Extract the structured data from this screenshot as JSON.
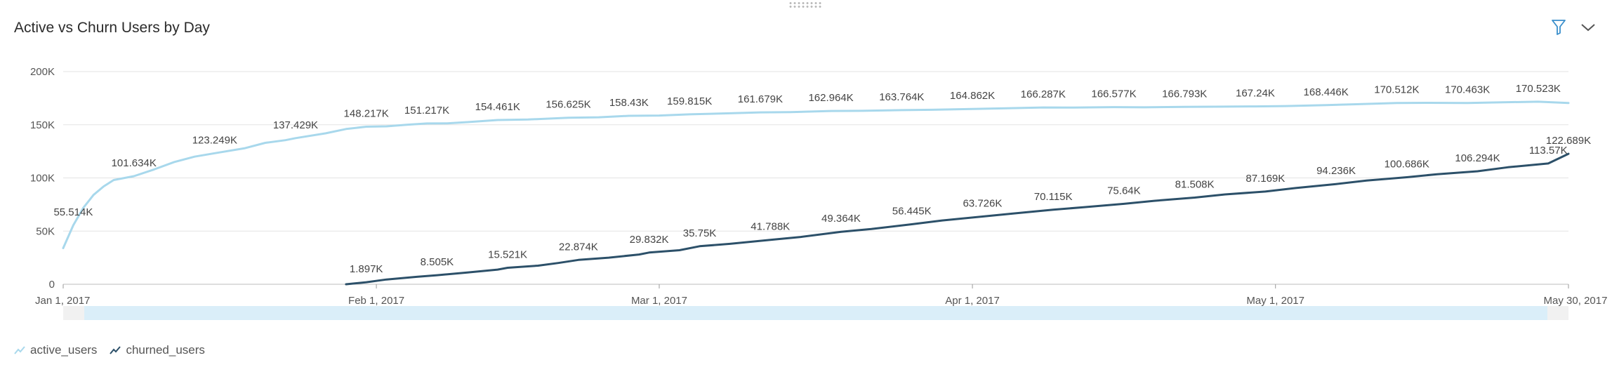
{
  "header": {
    "title": "Active vs Churn Users by Day",
    "filter_icon": "filter-icon",
    "collapse_icon": "chevron-down-icon"
  },
  "colors": {
    "active_users": "#a8d8ec",
    "churned_users": "#2c5069",
    "grid": "#e3e3e3",
    "slider": "#daeef9"
  },
  "chart_data": {
    "type": "line",
    "title": "Active vs Churn Users by Day",
    "xlabel": "",
    "ylabel": "",
    "x_range": [
      "2017-01-01",
      "2017-05-30"
    ],
    "ylim": [
      0,
      200000
    ],
    "y_ticks": [
      {
        "value": 0,
        "label": "0"
      },
      {
        "value": 50000,
        "label": "50K"
      },
      {
        "value": 100000,
        "label": "100K"
      },
      {
        "value": 150000,
        "label": "150K"
      },
      {
        "value": 200000,
        "label": "200K"
      }
    ],
    "x_ticks": [
      {
        "date": "2017-01-01",
        "label": "Jan 1, 2017"
      },
      {
        "date": "2017-02-01",
        "label": "Feb 1, 2017"
      },
      {
        "date": "2017-03-01",
        "label": "Mar 1, 2017"
      },
      {
        "date": "2017-04-01",
        "label": "Apr 1, 2017"
      },
      {
        "date": "2017-05-01",
        "label": "May 1, 2017"
      },
      {
        "date": "2017-05-30",
        "label": "May 30, 2017"
      }
    ],
    "grid": true,
    "legend": "bottom-left",
    "series": [
      {
        "name": "active_users",
        "points": [
          [
            "2017-01-01",
            34000
          ],
          [
            "2017-01-02",
            55514
          ],
          [
            "2017-01-03",
            72000
          ],
          [
            "2017-01-04",
            84000
          ],
          [
            "2017-01-05",
            92000
          ],
          [
            "2017-01-06",
            98000
          ],
          [
            "2017-01-08",
            101634
          ],
          [
            "2017-01-10",
            108000
          ],
          [
            "2017-01-12",
            115000
          ],
          [
            "2017-01-14",
            120000
          ],
          [
            "2017-01-16",
            123249
          ],
          [
            "2017-01-19",
            128000
          ],
          [
            "2017-01-21",
            133000
          ],
          [
            "2017-01-23",
            135500
          ],
          [
            "2017-01-24",
            137429
          ],
          [
            "2017-01-27",
            142000
          ],
          [
            "2017-01-29",
            146000
          ],
          [
            "2017-01-31",
            148217
          ],
          [
            "2017-02-02",
            148500
          ],
          [
            "2017-02-04",
            150000
          ],
          [
            "2017-02-06",
            151217
          ],
          [
            "2017-02-08",
            151300
          ],
          [
            "2017-02-10",
            152500
          ],
          [
            "2017-02-13",
            154461
          ],
          [
            "2017-02-16",
            154900
          ],
          [
            "2017-02-20",
            156625
          ],
          [
            "2017-02-23",
            157000
          ],
          [
            "2017-02-26",
            158430
          ],
          [
            "2017-03-01",
            158700
          ],
          [
            "2017-03-04",
            159815
          ],
          [
            "2017-03-08",
            160800
          ],
          [
            "2017-03-11",
            161679
          ],
          [
            "2017-03-14",
            161900
          ],
          [
            "2017-03-18",
            162964
          ],
          [
            "2017-03-21",
            163100
          ],
          [
            "2017-03-25",
            163764
          ],
          [
            "2017-03-28",
            164100
          ],
          [
            "2017-04-01",
            164862
          ],
          [
            "2017-04-04",
            165400
          ],
          [
            "2017-04-08",
            166287
          ],
          [
            "2017-04-11",
            166200
          ],
          [
            "2017-04-15",
            166577
          ],
          [
            "2017-04-18",
            166400
          ],
          [
            "2017-04-22",
            166793
          ],
          [
            "2017-04-25",
            167000
          ],
          [
            "2017-04-29",
            167240
          ],
          [
            "2017-05-02",
            167600
          ],
          [
            "2017-05-06",
            168446
          ],
          [
            "2017-05-09",
            169300
          ],
          [
            "2017-05-13",
            170512
          ],
          [
            "2017-05-16",
            170600
          ],
          [
            "2017-05-20",
            170463
          ],
          [
            "2017-05-23",
            171000
          ],
          [
            "2017-05-27",
            171700
          ],
          [
            "2017-05-30",
            170523
          ]
        ],
        "labels": [
          [
            "2017-01-02",
            "55.514K"
          ],
          [
            "2017-01-08",
            "101.634K"
          ],
          [
            "2017-01-16",
            "123.249K"
          ],
          [
            "2017-01-24",
            "137.429K"
          ],
          [
            "2017-01-31",
            "148.217K"
          ],
          [
            "2017-02-06",
            "151.217K"
          ],
          [
            "2017-02-13",
            "154.461K"
          ],
          [
            "2017-02-20",
            "156.625K"
          ],
          [
            "2017-02-26",
            "158.43K"
          ],
          [
            "2017-03-04",
            "159.815K"
          ],
          [
            "2017-03-11",
            "161.679K"
          ],
          [
            "2017-03-18",
            "162.964K"
          ],
          [
            "2017-03-25",
            "163.764K"
          ],
          [
            "2017-04-01",
            "164.862K"
          ],
          [
            "2017-04-08",
            "166.287K"
          ],
          [
            "2017-04-15",
            "166.577K"
          ],
          [
            "2017-04-22",
            "166.793K"
          ],
          [
            "2017-04-29",
            "167.24K"
          ],
          [
            "2017-05-06",
            "168.446K"
          ],
          [
            "2017-05-13",
            "170.512K"
          ],
          [
            "2017-05-20",
            "170.463K"
          ],
          [
            "2017-05-27",
            "170.523K"
          ]
        ]
      },
      {
        "name": "churned_users",
        "points": [
          [
            "2017-01-29",
            0
          ],
          [
            "2017-01-31",
            1897
          ],
          [
            "2017-02-02",
            4500
          ],
          [
            "2017-02-05",
            7000
          ],
          [
            "2017-02-07",
            8505
          ],
          [
            "2017-02-10",
            11000
          ],
          [
            "2017-02-13",
            13800
          ],
          [
            "2017-02-14",
            15521
          ],
          [
            "2017-02-17",
            17500
          ],
          [
            "2017-02-19",
            20000
          ],
          [
            "2017-02-21",
            22874
          ],
          [
            "2017-02-24",
            25000
          ],
          [
            "2017-02-27",
            28000
          ],
          [
            "2017-02-28",
            29832
          ],
          [
            "2017-03-03",
            32000
          ],
          [
            "2017-03-05",
            35750
          ],
          [
            "2017-03-08",
            38000
          ],
          [
            "2017-03-12",
            41788
          ],
          [
            "2017-03-15",
            44500
          ],
          [
            "2017-03-19",
            49364
          ],
          [
            "2017-03-22",
            52000
          ],
          [
            "2017-03-26",
            56445
          ],
          [
            "2017-03-29",
            60000
          ],
          [
            "2017-04-02",
            63726
          ],
          [
            "2017-04-05",
            66500
          ],
          [
            "2017-04-09",
            70115
          ],
          [
            "2017-04-12",
            72500
          ],
          [
            "2017-04-16",
            75640
          ],
          [
            "2017-04-19",
            78500
          ],
          [
            "2017-04-23",
            81508
          ],
          [
            "2017-04-26",
            84500
          ],
          [
            "2017-04-30",
            87169
          ],
          [
            "2017-05-03",
            90500
          ],
          [
            "2017-05-07",
            94236
          ],
          [
            "2017-05-10",
            97500
          ],
          [
            "2017-05-14",
            100686
          ],
          [
            "2017-05-17",
            103500
          ],
          [
            "2017-05-21",
            106294
          ],
          [
            "2017-05-24",
            110000
          ],
          [
            "2017-05-28",
            113570
          ],
          [
            "2017-05-30",
            122689
          ]
        ],
        "labels": [
          [
            "2017-01-31",
            "1.897K"
          ],
          [
            "2017-02-07",
            "8.505K"
          ],
          [
            "2017-02-14",
            "15.521K"
          ],
          [
            "2017-02-21",
            "22.874K"
          ],
          [
            "2017-02-28",
            "29.832K"
          ],
          [
            "2017-03-05",
            "35.75K"
          ],
          [
            "2017-03-12",
            "41.788K"
          ],
          [
            "2017-03-19",
            "49.364K"
          ],
          [
            "2017-03-26",
            "56.445K"
          ],
          [
            "2017-04-02",
            "63.726K"
          ],
          [
            "2017-04-09",
            "70.115K"
          ],
          [
            "2017-04-16",
            "75.64K"
          ],
          [
            "2017-04-23",
            "81.508K"
          ],
          [
            "2017-04-30",
            "87.169K"
          ],
          [
            "2017-05-07",
            "94.236K"
          ],
          [
            "2017-05-14",
            "100.686K"
          ],
          [
            "2017-05-21",
            "106.294K"
          ],
          [
            "2017-05-28",
            "113.57K"
          ],
          [
            "2017-05-30",
            "122.689K"
          ]
        ]
      }
    ],
    "range_selector": {
      "start": "2017-01-01",
      "end": "2017-05-30"
    }
  },
  "legend": {
    "items": [
      {
        "name": "active_users",
        "label": "active_users"
      },
      {
        "name": "churned_users",
        "label": "churned_users"
      }
    ]
  }
}
